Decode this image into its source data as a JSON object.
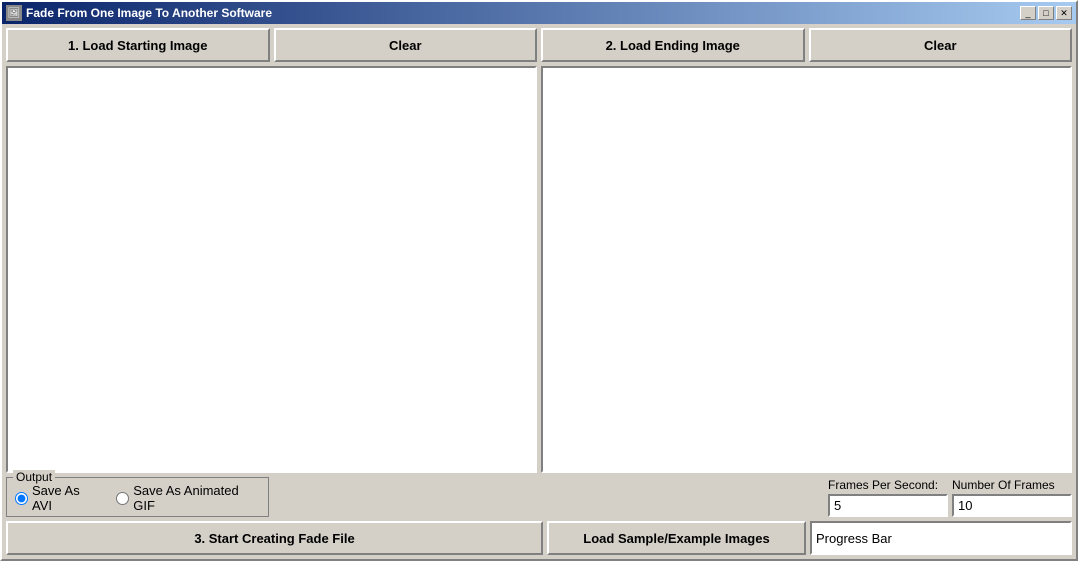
{
  "window": {
    "title": "Fade From One Image To Another Software",
    "controls": {
      "minimize": "_",
      "maximize": "□",
      "close": "✕"
    }
  },
  "toolbar": {
    "load_start_label": "1. Load Starting Image",
    "clear_left_label": "Clear",
    "load_end_label": "2. Load Ending Image",
    "clear_right_label": "Clear"
  },
  "output_group": {
    "legend": "Output",
    "save_avi_label": "Save As AVI",
    "save_gif_label": "Save As Animated GIF"
  },
  "frames": {
    "fps_label": "Frames Per Second:",
    "fps_value": "5",
    "nof_label": "Number Of Frames",
    "nof_value": "10"
  },
  "actions": {
    "start_label": "3. Start Creating Fade File",
    "sample_label": "Load Sample/Example Images",
    "progress_label": "Progress Bar"
  }
}
